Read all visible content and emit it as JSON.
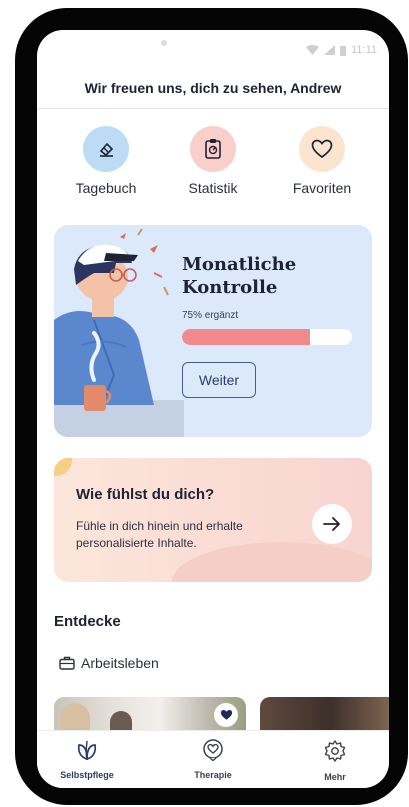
{
  "status": {
    "time": "11:11"
  },
  "header": {
    "greeting": "Wir freuen uns, dich zu sehen, Andrew"
  },
  "quick_actions": [
    {
      "label": "Tagebuch",
      "icon": "pencil-eraser-icon",
      "color": "#bcdcf6"
    },
    {
      "label": "Statistik",
      "icon": "clipboard-stats-icon",
      "color": "#f9cfcb"
    },
    {
      "label": "Favoriten",
      "icon": "heart-icon",
      "color": "#fbe5cf"
    }
  ],
  "monthly_check": {
    "title_line1": "Monatliche",
    "title_line2": "Kontrolle",
    "progress_label": "75% ergänzt",
    "progress": 0.75,
    "button_label": "Weiter"
  },
  "mood_card": {
    "title": "Wie fühlst du dich?",
    "text": "Fühle in dich hinein und erhalte personalisierte Inhalte."
  },
  "discover": {
    "title": "Entdecke",
    "topic": "Arbeitsleben"
  },
  "tabbar": {
    "items": [
      {
        "label": "Selbstpflege",
        "icon": "leaf-icon",
        "active": true
      },
      {
        "label": "Therapie",
        "icon": "heart-bubble-icon",
        "active": false
      },
      {
        "label": "Mehr",
        "icon": "gear-icon",
        "active": false
      }
    ]
  },
  "colors": {
    "accent": "#f08a8c",
    "primary_text": "#1d2235",
    "button_border": "#4a5a8a"
  }
}
